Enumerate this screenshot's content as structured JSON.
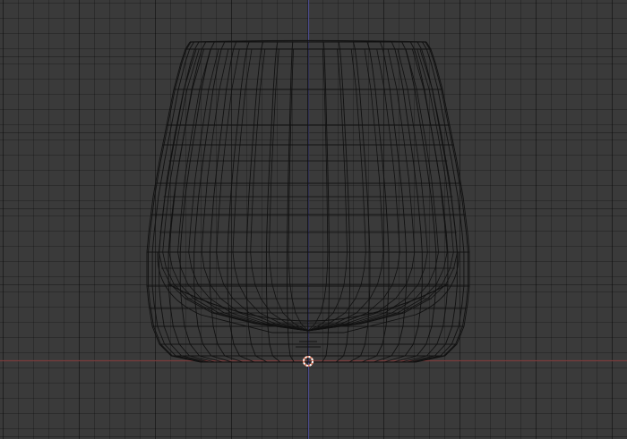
{
  "viewport": {
    "background_color": "#3a3a3a",
    "grid_color": "#2e2e2e",
    "x_axis_color": "#7a3c3c",
    "y_axis_color": "#4b4b8c"
  },
  "mesh": {
    "object": "glass",
    "wire_color": "#111111",
    "vertical_segments": 24,
    "horizontal_rings": 11
  },
  "origin_marker": {
    "icon": "3d-cursor-icon",
    "ring_color": "#e07a5f",
    "dash_color": "#ffffff"
  }
}
